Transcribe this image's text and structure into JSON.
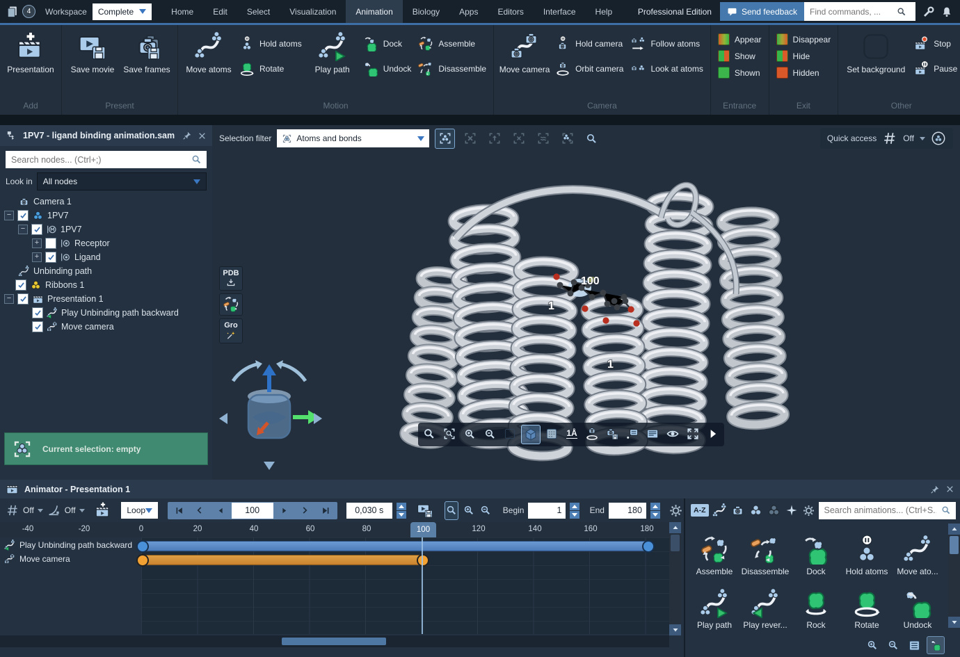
{
  "colors": {
    "accent_blue": "#4d7fb5",
    "green": "#2ec473",
    "entrance_green": "#3cb54a",
    "exit_orange": "#d9582a",
    "bar_blue": "#4d7cba",
    "bar_orange": "#c9832f",
    "selection_green": "#3f8a70"
  },
  "titlebar": {
    "badge": "4",
    "workspace_label": "Workspace",
    "workspace_value": "Complete",
    "menus": [
      "Home",
      "Edit",
      "Select",
      "Visualization",
      "Animation",
      "Biology",
      "Apps",
      "Editors",
      "Interface",
      "Help"
    ],
    "active_menu": "Animation",
    "edition": "Professional Edition",
    "send_feedback": "Send feedback",
    "find_placeholder": "Find commands, ..."
  },
  "ribbon": {
    "groups": [
      {
        "name": "Add"
      },
      {
        "name": "Present"
      },
      {
        "name": "Motion"
      },
      {
        "name": "Camera"
      },
      {
        "name": "Entrance"
      },
      {
        "name": "Exit"
      },
      {
        "name": "Other"
      }
    ],
    "items": {
      "presentation": "Presentation",
      "save_movie": "Save movie",
      "save_frames": "Save frames",
      "move_atoms": "Move atoms",
      "hold_atoms": "Hold atoms",
      "rotate": "Rotate",
      "play_path": "Play path",
      "dock": "Dock",
      "undock": "Undock",
      "assemble": "Assemble",
      "disassemble": "Disassemble",
      "move_camera": "Move camera",
      "hold_camera": "Hold camera",
      "orbit_camera": "Orbit camera",
      "follow_atoms": "Follow atoms",
      "look_at_atoms": "Look at atoms",
      "appear": "Appear",
      "show": "Show",
      "shown": "Shown",
      "disappear": "Disappear",
      "hide": "Hide",
      "hidden": "Hidden",
      "set_background": "Set background",
      "stop": "Stop",
      "pause": "Pause"
    }
  },
  "document_panel": {
    "title": "1PV7 - ligand binding animation.sam",
    "search_placeholder": "Search nodes... (Ctrl+;)",
    "look_in_label": "Look in",
    "look_in_value": "All nodes",
    "tree": [
      {
        "label": "Camera 1",
        "icon": "camera",
        "depth": 0,
        "checkbox": null,
        "expander": null
      },
      {
        "label": "1PV7",
        "icon": "molecule-blue",
        "depth": 0,
        "checkbox": true,
        "expander": "minus"
      },
      {
        "label": "1PV7",
        "icon": "structural-model",
        "depth": 1,
        "checkbox": true,
        "expander": "minus"
      },
      {
        "label": "Receptor",
        "icon": "chain",
        "depth": 2,
        "checkbox": false,
        "expander": "plus"
      },
      {
        "label": "Ligand",
        "icon": "chain",
        "depth": 2,
        "checkbox": true,
        "expander": "plus"
      },
      {
        "label": "Unbinding path",
        "icon": "path",
        "depth": 0,
        "checkbox": null,
        "expander": null
      },
      {
        "label": "Ribbons 1",
        "icon": "molecule-yellow",
        "depth": 0,
        "checkbox": true,
        "expander": null
      },
      {
        "label": "Presentation 1",
        "icon": "presentation",
        "depth": 0,
        "checkbox": true,
        "expander": "minus"
      },
      {
        "label": "Play Unbinding path backward",
        "icon": "play-path-reverse",
        "depth": 1,
        "checkbox": true,
        "expander": null
      },
      {
        "label": "Move camera",
        "icon": "move-camera",
        "depth": 1,
        "checkbox": true,
        "expander": null
      }
    ],
    "selection_status": "Current selection: empty"
  },
  "viewport": {
    "selection_filter_label": "Selection filter",
    "selection_filter_value": "Atoms and bonds",
    "quick_access_label": "Quick access",
    "quick_access_value": "Off",
    "pdb_button": "PDB",
    "gro_button": "Gro",
    "scale_button": "1Å",
    "scene_labels": {
      "frame": "100",
      "start": "1",
      "end": "1"
    }
  },
  "animator": {
    "title": "Animator - Presentation 1",
    "grid_value": "Off",
    "interpolation_value": "Off",
    "loop_value": "Loop",
    "current_frame": "100",
    "frame_time": "0,030 s",
    "begin_label": "Begin",
    "begin_value": "1",
    "end_label": "End",
    "end_value": "180",
    "ruler": [
      "-40",
      "-20",
      "0",
      "20",
      "40",
      "60",
      "80",
      "100",
      "120",
      "140",
      "160",
      "180"
    ],
    "tracks": [
      {
        "label": "Play Unbinding path backward",
        "start": 0,
        "end": 180,
        "color": "blue"
      },
      {
        "label": "Move camera",
        "start": 0,
        "end": 100,
        "color": "orange"
      }
    ]
  },
  "library": {
    "sort_label": "A-Z",
    "search_placeholder": "Search animations... (Ctrl+S...",
    "items": [
      "Assemble",
      "Disassemble",
      "Dock",
      "Hold atoms",
      "Move ato...",
      "Play path",
      "Play rever...",
      "Rock",
      "Rotate",
      "Undock"
    ]
  }
}
